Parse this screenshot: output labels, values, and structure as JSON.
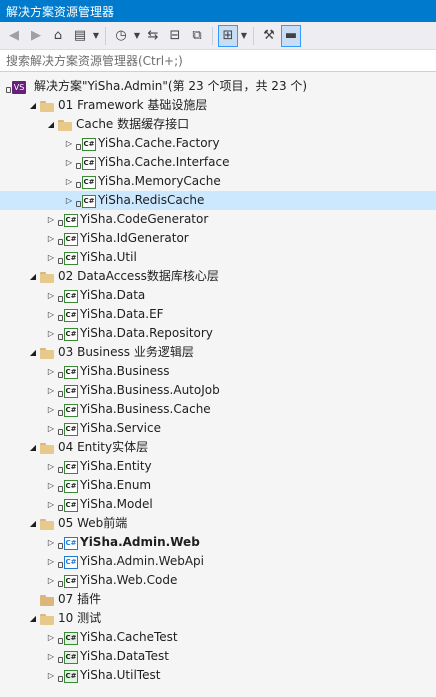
{
  "window": {
    "title": "解决方案资源管理器"
  },
  "toolbar": {
    "buttons": [
      {
        "name": "back-icon",
        "glyph": "◀"
      },
      {
        "name": "forward-icon",
        "glyph": "▶"
      },
      {
        "name": "home-icon",
        "glyph": "⌂"
      },
      {
        "name": "switch-views-icon",
        "glyph": "▤"
      },
      {
        "name": "pending-changes-icon",
        "glyph": "◷"
      },
      {
        "name": "sync-icon",
        "glyph": "⇆"
      },
      {
        "name": "collapse-all-icon",
        "glyph": "⊟"
      },
      {
        "name": "show-all-files-icon",
        "glyph": "⧉"
      },
      {
        "name": "filter-icon",
        "glyph": "⊞"
      },
      {
        "name": "properties-icon",
        "glyph": "🔧"
      },
      {
        "name": "preview-icon",
        "glyph": "▬"
      }
    ]
  },
  "search": {
    "placeholder": "搜索解决方案资源管理器(Ctrl+;)"
  },
  "tree": [
    {
      "label": "解决方案\"YiSha.Admin\"(第 23 个项目，共 23 个)",
      "type": "solution",
      "level": 0,
      "expander": "none"
    },
    {
      "label": "01 Framework 基础设施层",
      "type": "folder",
      "level": 1,
      "expander": "open"
    },
    {
      "label": "Cache 数据缓存接口",
      "type": "folder",
      "level": 2,
      "expander": "open"
    },
    {
      "label": "YiSha.Cache.Factory",
      "type": "cs",
      "level": 3,
      "expander": "closed"
    },
    {
      "label": "YiSha.Cache.Interface",
      "type": "cs",
      "level": 3,
      "expander": "closed"
    },
    {
      "label": "YiSha.MemoryCache",
      "type": "cs",
      "level": 3,
      "expander": "closed"
    },
    {
      "label": "YiSha.RedisCache",
      "type": "cs",
      "level": 3,
      "expander": "closed",
      "selected": true
    },
    {
      "label": "YiSha.CodeGenerator",
      "type": "cs",
      "level": 2,
      "expander": "closed"
    },
    {
      "label": "YiSha.IdGenerator",
      "type": "cs",
      "level": 2,
      "expander": "closed"
    },
    {
      "label": "YiSha.Util",
      "type": "cs",
      "level": 2,
      "expander": "closed"
    },
    {
      "label": "02 DataAccess数据库核心层",
      "type": "folder",
      "level": 1,
      "expander": "open"
    },
    {
      "label": "YiSha.Data",
      "type": "cs",
      "level": 2,
      "expander": "closed"
    },
    {
      "label": "YiSha.Data.EF",
      "type": "cs",
      "level": 2,
      "expander": "closed"
    },
    {
      "label": "YiSha.Data.Repository",
      "type": "cs",
      "level": 2,
      "expander": "closed"
    },
    {
      "label": "03 Business 业务逻辑层",
      "type": "folder",
      "level": 1,
      "expander": "open"
    },
    {
      "label": "YiSha.Business",
      "type": "cs",
      "level": 2,
      "expander": "closed"
    },
    {
      "label": "YiSha.Business.AutoJob",
      "type": "cs",
      "level": 2,
      "expander": "closed"
    },
    {
      "label": "YiSha.Business.Cache",
      "type": "cs",
      "level": 2,
      "expander": "closed"
    },
    {
      "label": "YiSha.Service",
      "type": "cs",
      "level": 2,
      "expander": "closed"
    },
    {
      "label": "04 Entity实体层",
      "type": "folder",
      "level": 1,
      "expander": "open"
    },
    {
      "label": "YiSha.Entity",
      "type": "cs",
      "level": 2,
      "expander": "closed"
    },
    {
      "label": "YiSha.Enum",
      "type": "cs",
      "level": 2,
      "expander": "closed"
    },
    {
      "label": "YiSha.Model",
      "type": "cs",
      "level": 2,
      "expander": "closed"
    },
    {
      "label": "05 Web前端",
      "type": "folder",
      "level": 1,
      "expander": "open"
    },
    {
      "label": "YiSha.Admin.Web",
      "type": "web",
      "level": 2,
      "expander": "closed",
      "bold": true
    },
    {
      "label": "YiSha.Admin.WebApi",
      "type": "web",
      "level": 2,
      "expander": "closed"
    },
    {
      "label": "YiSha.Web.Code",
      "type": "cs",
      "level": 2,
      "expander": "closed"
    },
    {
      "label": "07 插件",
      "type": "folder-closed",
      "level": 1,
      "expander": "none"
    },
    {
      "label": "10 测试",
      "type": "folder",
      "level": 1,
      "expander": "open"
    },
    {
      "label": "YiSha.CacheTest",
      "type": "test",
      "level": 2,
      "expander": "closed"
    },
    {
      "label": "YiSha.DataTest",
      "type": "test",
      "level": 2,
      "expander": "closed"
    },
    {
      "label": "YiSha.UtilTest",
      "type": "test",
      "level": 2,
      "expander": "closed"
    }
  ],
  "icon_text": {
    "cs": "C#",
    "sln": "VS"
  },
  "colors": {
    "title_bar": "#007acc",
    "selection": "#cce8ff",
    "folder": "#dcb67a"
  }
}
